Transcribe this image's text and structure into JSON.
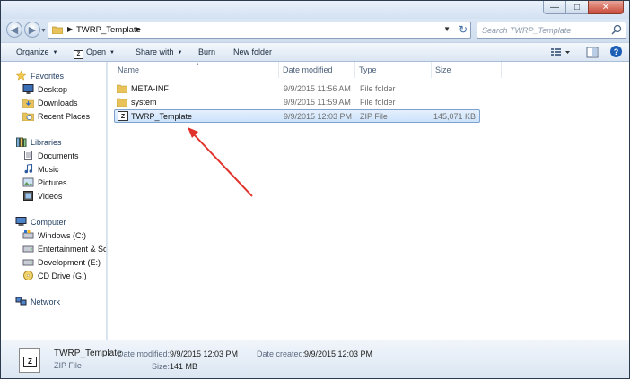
{
  "window": {
    "caption_buttons": [
      "minimize",
      "maximize",
      "close"
    ]
  },
  "address": {
    "path": "TWRP_Template",
    "search_placeholder": "Search TWRP_Template"
  },
  "toolbar": {
    "organize": "Organize",
    "open": "Open",
    "share_with": "Share with",
    "burn": "Burn",
    "new_folder": "New folder",
    "zip_badge": "Z"
  },
  "nav": {
    "favorites": {
      "label": "Favorites",
      "items": [
        "Desktop",
        "Downloads",
        "Recent Places"
      ]
    },
    "libraries": {
      "label": "Libraries",
      "items": [
        "Documents",
        "Music",
        "Pictures",
        "Videos"
      ]
    },
    "computer": {
      "label": "Computer",
      "items": [
        "Windows (C:)",
        "Entertainment & Sof",
        "Development (E:)",
        "CD Drive (G:)"
      ]
    },
    "network": {
      "label": "Network"
    }
  },
  "columns": {
    "name": "Name",
    "date_modified": "Date modified",
    "type": "Type",
    "size": "Size"
  },
  "files": [
    {
      "name": "META-INF",
      "date": "9/9/2015 11:56 AM",
      "type": "File folder",
      "size": "",
      "icon": "folder-icon",
      "selected": false
    },
    {
      "name": "system",
      "date": "9/9/2015 11:59 AM",
      "type": "File folder",
      "size": "",
      "icon": "folder-icon",
      "selected": false
    },
    {
      "name": "TWRP_Template",
      "date": "9/9/2015 12:03 PM",
      "type": "ZIP File",
      "size": "145,071 KB",
      "icon": "zip-file-icon",
      "selected": true
    }
  ],
  "details": {
    "name": "TWRP_Template",
    "type": "ZIP File",
    "date_modified_label": "Date modified:",
    "date_modified": "9/9/2015 12:03 PM",
    "date_created_label": "Date created:",
    "date_created": "9/9/2015 12:03 PM",
    "size_label": "Size:",
    "size": "141 MB"
  },
  "colors": {
    "annotation_arrow": "#e0322a",
    "selection": "#cce2fb",
    "help": "#1d5fb5"
  }
}
